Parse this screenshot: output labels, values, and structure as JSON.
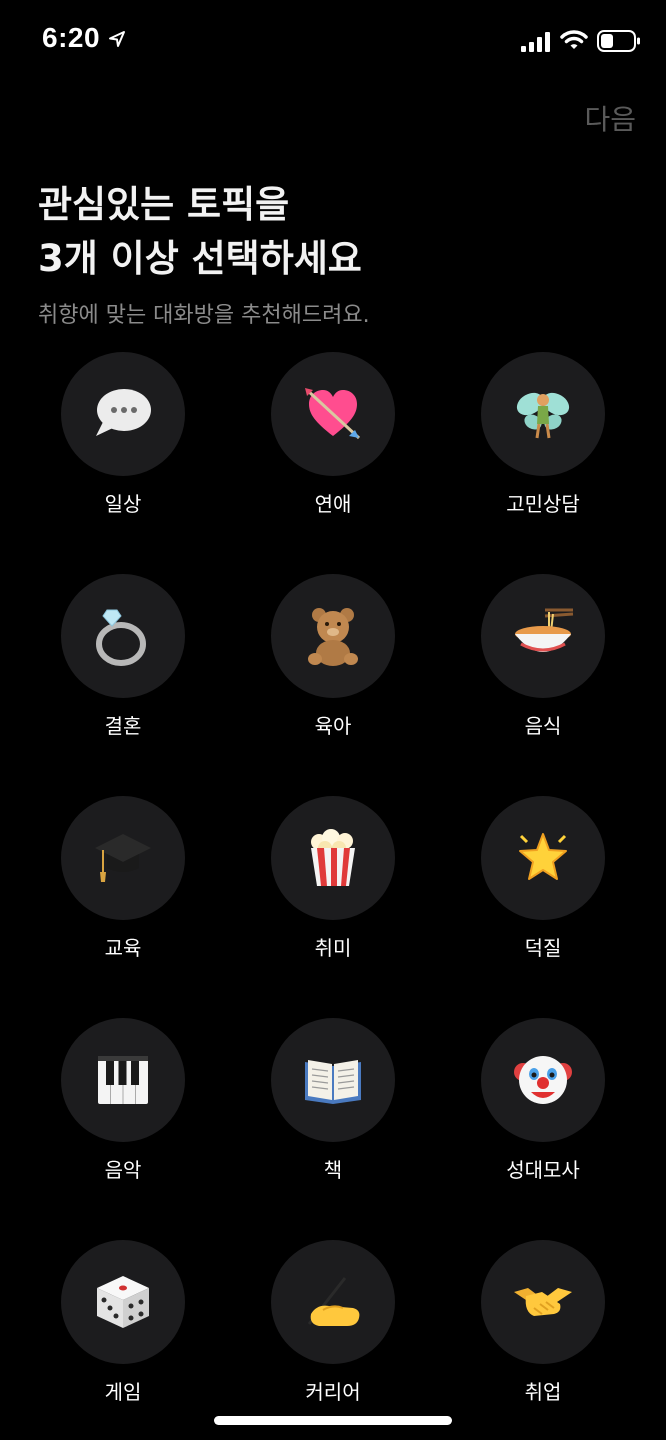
{
  "status_bar": {
    "time": "6:20"
  },
  "header": {
    "next_label": "다음",
    "title_line1": "관심있는 토픽을",
    "title_line2": "3개 이상 선택하세요",
    "subtitle": "취향에 맞는 대화방을 추천해드려요."
  },
  "topics": [
    {
      "label": "일상",
      "icon": "speech-bubble-icon"
    },
    {
      "label": "연애",
      "icon": "heart-arrow-icon"
    },
    {
      "label": "고민상담",
      "icon": "fairy-icon"
    },
    {
      "label": "결혼",
      "icon": "ring-icon"
    },
    {
      "label": "육아",
      "icon": "teddy-bear-icon"
    },
    {
      "label": "음식",
      "icon": "noodle-bowl-icon"
    },
    {
      "label": "교육",
      "icon": "graduation-cap-icon"
    },
    {
      "label": "취미",
      "icon": "popcorn-icon"
    },
    {
      "label": "덕질",
      "icon": "star-icon"
    },
    {
      "label": "음악",
      "icon": "piano-icon"
    },
    {
      "label": "책",
      "icon": "open-book-icon"
    },
    {
      "label": "성대모사",
      "icon": "clown-face-icon"
    },
    {
      "label": "게임",
      "icon": "dice-icon"
    },
    {
      "label": "커리어",
      "icon": "writing-hand-icon"
    },
    {
      "label": "취업",
      "icon": "handshake-icon"
    }
  ],
  "colors": {
    "background": "#000000",
    "circle": "#1c1c1e",
    "next_disabled": "#5a5a5a",
    "subtitle": "#8b8b8b"
  }
}
